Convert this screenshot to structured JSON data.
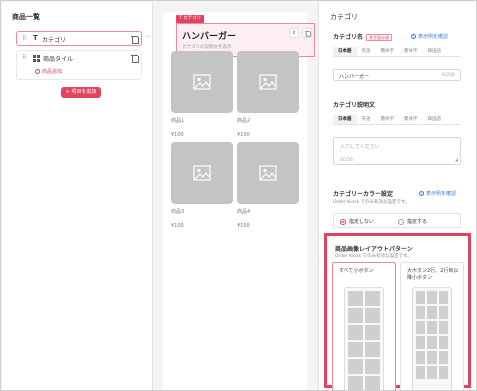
{
  "left": {
    "title": "商品一覧",
    "category_item_label": "カテゴリ",
    "tile_item_label": "商品タイル",
    "tile_add_product": "商品追加",
    "add_item_button": "+ 項目を追加"
  },
  "preview": {
    "category_tag": "T カテゴリ",
    "category_name": "ハンバーガー",
    "category_description": "カテゴリの説明文を表示",
    "products": [
      {
        "name": "商品1",
        "price": "¥100"
      },
      {
        "name": "商品2",
        "price": "¥100"
      },
      {
        "name": "商品3",
        "price": "¥100"
      },
      {
        "name": "商品4",
        "price": "¥100"
      }
    ]
  },
  "settings": {
    "title": "カテゴリ",
    "category_name_label": "カテゴリ名",
    "required_badge": "多言語必須",
    "show_example": "表示例を確認",
    "name_tabs": [
      "日本語",
      "英語",
      "簡体字",
      "繁体字",
      "韓国語"
    ],
    "name_value": "ハンバーガー",
    "name_count": "6/256",
    "desc_label": "カテゴリ説明文",
    "desc_tabs": [
      "日本語",
      "英語",
      "簡体字",
      "繁体字",
      "韓国語"
    ],
    "desc_placeholder": "入力してください",
    "desc_count": "0/256",
    "color_label": "カテゴリーカラー設定",
    "color_note": "Order Kiosk でのみ有効な設定です。",
    "radio_off": "指定しない",
    "radio_on": "指定する"
  },
  "layout_pattern": {
    "title": "商品画像レイアウトパターン",
    "note": "Order Kiosk でのみ有効な設定です。",
    "option1_label": "すべて小ボタン",
    "option2_label_line1": "大ボタン2行、2行目以",
    "option2_label_line2": "降小ボタン"
  },
  "colors": {
    "accent": "#e0445f",
    "link": "#3a7bd5",
    "placeholder_gray": "#c4c4c4"
  }
}
